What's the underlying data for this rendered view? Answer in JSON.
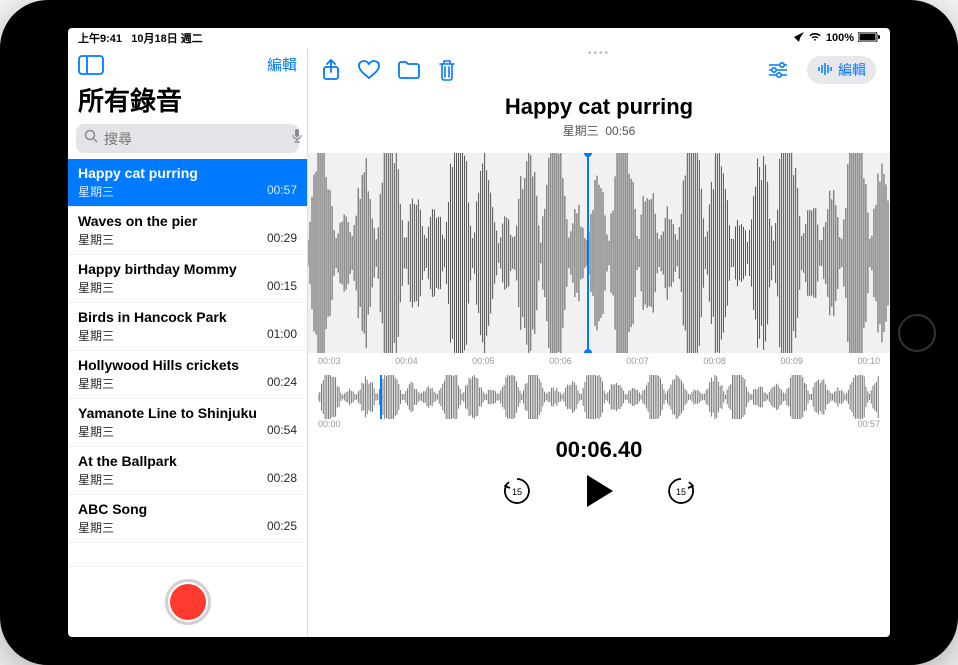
{
  "status": {
    "time": "上午9:41",
    "date": "10月18日 週二",
    "battery": "100%"
  },
  "sidebar": {
    "edit": "編輯",
    "title": "所有錄音",
    "search_placeholder": "搜尋"
  },
  "recordings": [
    {
      "title": "Happy cat purring",
      "day": "星期三",
      "dur": "00:57",
      "selected": true
    },
    {
      "title": "Waves on the pier",
      "day": "星期三",
      "dur": "00:29"
    },
    {
      "title": "Happy birthday Mommy",
      "day": "星期三",
      "dur": "00:15"
    },
    {
      "title": "Birds in Hancock Park",
      "day": "星期三",
      "dur": "01:00"
    },
    {
      "title": "Hollywood Hills crickets",
      "day": "星期三",
      "dur": "00:24"
    },
    {
      "title": "Yamanote Line to Shinjuku",
      "day": "星期三",
      "dur": "00:54"
    },
    {
      "title": "At the Ballpark",
      "day": "星期三",
      "dur": "00:28"
    },
    {
      "title": "ABC Song",
      "day": "星期三",
      "dur": "00:25"
    }
  ],
  "main": {
    "title": "Happy cat purring",
    "sub_day": "星期三",
    "sub_dur": "00:56",
    "edit": "編輯",
    "timecode": "00:06.40",
    "ruler": [
      "00:03",
      "00:04",
      "00:05",
      "00:06",
      "00:07",
      "00:08",
      "00:09",
      "00:10"
    ],
    "mini_ruler_start": "00:00",
    "mini_ruler_end": "00:57",
    "skip": "15"
  },
  "colors": {
    "accent": "#007aff",
    "record": "#ff3b30"
  }
}
